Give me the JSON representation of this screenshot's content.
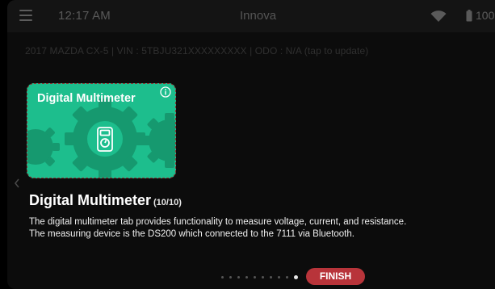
{
  "status_bar": {
    "time": "12:17 AM",
    "app_title": "Innova",
    "battery_percent": "100%"
  },
  "vehicle": {
    "info_text": "2017 MAZDA CX-5  |  VIN : 5TBJU321XXXXXXXXX  |  ODO : N/A (tap to update)"
  },
  "card": {
    "title": "Digital Multimeter",
    "background_color": "#1dbe8d"
  },
  "feature": {
    "heading": "Digital Multimeter",
    "count": "(10/10)",
    "description_lines": [
      "The digital multimeter tab provides functionality to measure voltage, current, and resistance.",
      "The measuring device is the DS200 which connected to the 7111 via Bluetooth."
    ]
  },
  "pagination": {
    "total_pages": 10,
    "current_page": 10
  },
  "finish_button": {
    "label": "FINISH",
    "color": "#b8343a"
  },
  "icons": [
    "hamburger-menu-icon",
    "wifi-icon",
    "battery-icon",
    "info-icon",
    "multimeter-icon",
    "gear-icon",
    "chevron-left-icon"
  ]
}
